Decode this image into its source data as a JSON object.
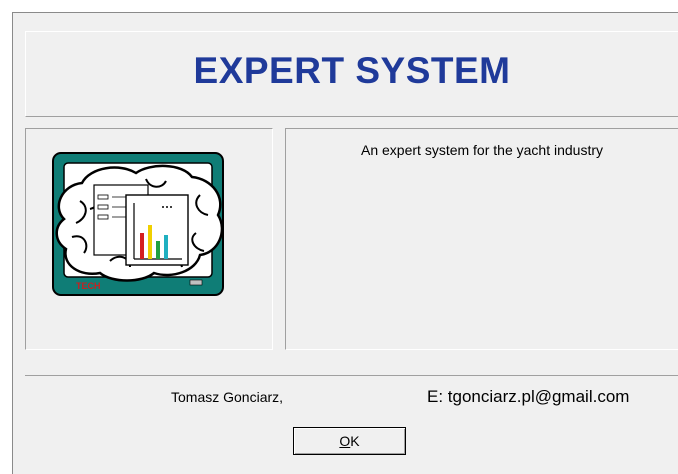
{
  "header": {
    "title": "EXPERT SYSTEM"
  },
  "description": "An expert system for the yacht industry",
  "logo": {
    "text": "TECH"
  },
  "footer": {
    "author": "Tomasz Gonciarz,",
    "email": "E:  tgonciarz.pl@gmail.com"
  },
  "ok_button": {
    "mnemonic": "O",
    "rest": "K"
  },
  "colors": {
    "title": "#1f3a9a",
    "monitor": "#0f7d76",
    "panel": "#f0f0f0"
  }
}
